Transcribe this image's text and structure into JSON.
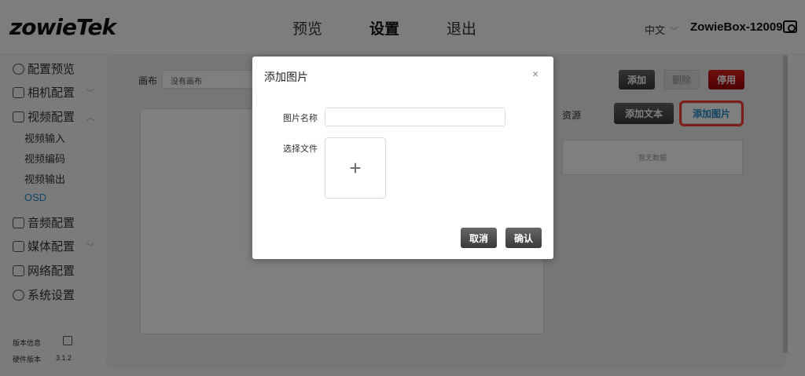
{
  "header": {
    "logo": "zowieTek",
    "nav": [
      "预览",
      "设置",
      "退出"
    ],
    "active_nav": "设置",
    "language": "中文",
    "device_name": "ZowieBox-12009",
    "camera_icon": "camera-icon"
  },
  "sidebar": {
    "items": [
      {
        "label": "配置预览",
        "icon": "preview-icon"
      },
      {
        "label": "相机配置",
        "icon": "camera-icon"
      },
      {
        "label": "视频配置",
        "icon": "film-icon"
      },
      {
        "label": "音频配置",
        "icon": "audio-icon"
      },
      {
        "label": "媒体配置",
        "icon": "media-icon"
      },
      {
        "label": "网络配置",
        "icon": "network-icon"
      },
      {
        "label": "系统设置",
        "icon": "gear-icon"
      }
    ],
    "video_sub": [
      "视频输入",
      "视频编码",
      "视频输出",
      "OSD"
    ],
    "active_sub": "OSD",
    "version_title": "版本信息",
    "hardware_label": "硬件版本",
    "hardware_version": "3.1.2"
  },
  "main": {
    "canvas_label": "画布",
    "canvas_select": "没有画布",
    "buttons": {
      "add": "添加",
      "delete": "删除",
      "disable": "停用"
    },
    "resource_label": "资源",
    "add_text": "添加文本",
    "add_image": "添加图片",
    "empty_text": "暂无数据"
  },
  "modal": {
    "title": "添加图片",
    "close": "×",
    "name_label": "图片名称",
    "name_value": "",
    "file_label": "选择文件",
    "upload_symbol": "+",
    "cancel": "取消",
    "confirm": "确认"
  },
  "colors": {
    "accent": "#1e88c7",
    "danger": "#c00000",
    "highlight": "#ff3b30"
  }
}
